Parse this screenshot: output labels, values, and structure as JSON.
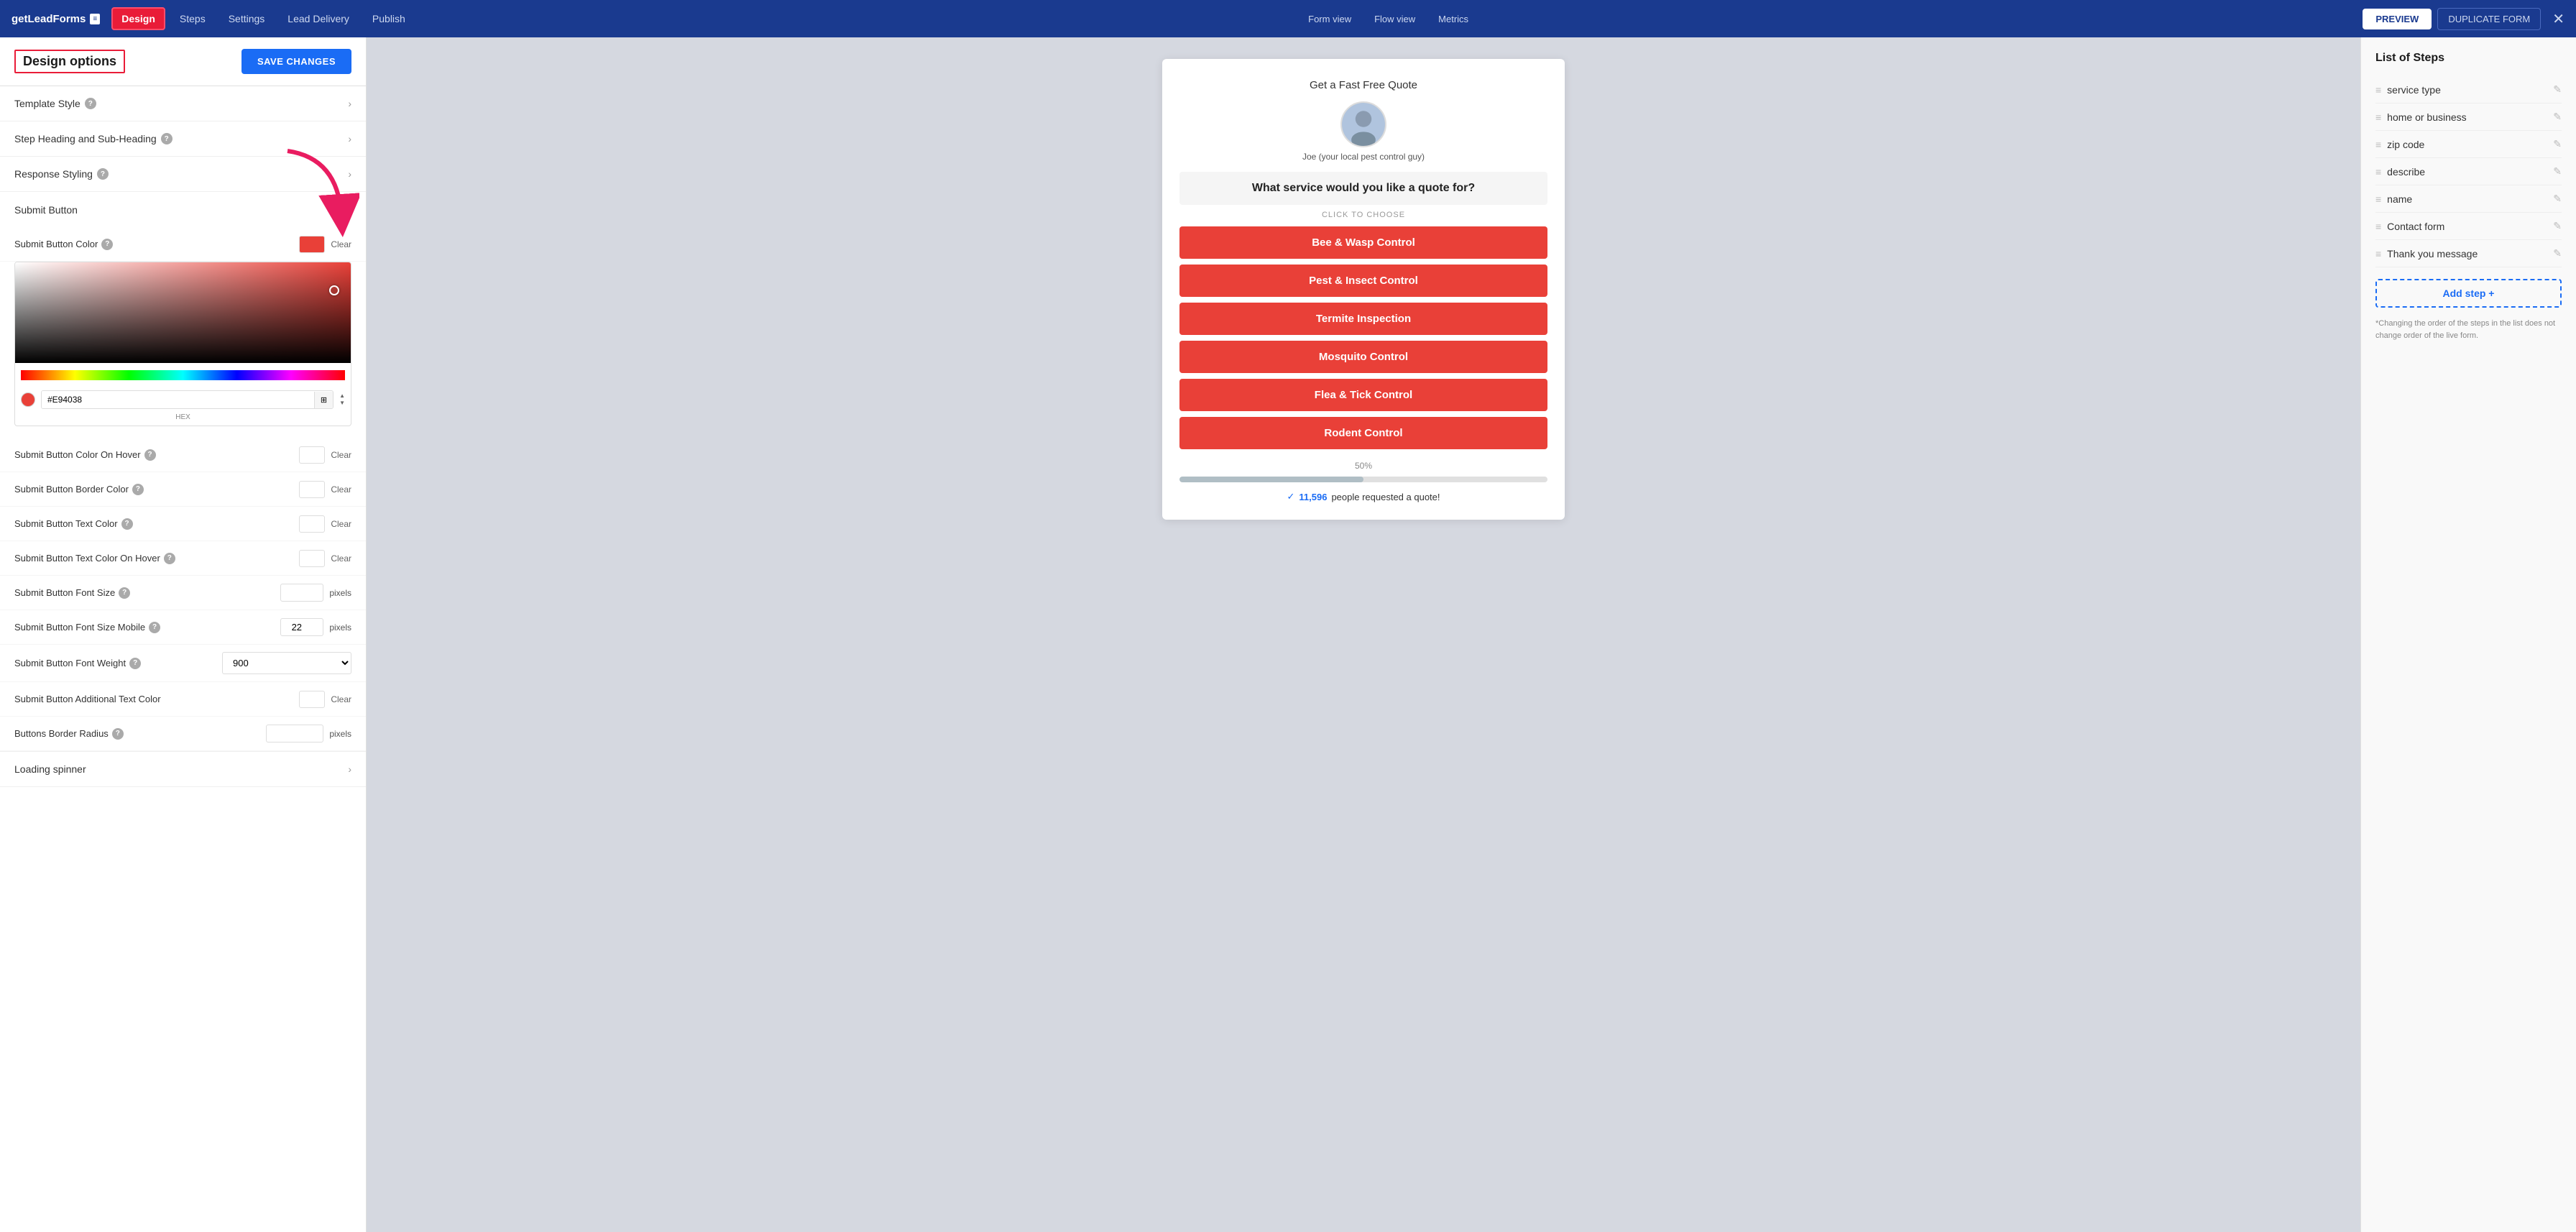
{
  "app": {
    "logo": "getLeadForms",
    "logo_icon": "≡"
  },
  "nav": {
    "items": [
      {
        "id": "design",
        "label": "Design",
        "active": true
      },
      {
        "id": "steps",
        "label": "Steps",
        "active": false
      },
      {
        "id": "settings",
        "label": "Settings",
        "active": false
      },
      {
        "id": "lead-delivery",
        "label": "Lead Delivery",
        "active": false
      },
      {
        "id": "publish",
        "label": "Publish",
        "active": false
      }
    ],
    "view_buttons": [
      {
        "id": "form-view",
        "label": "Form view"
      },
      {
        "id": "flow-view",
        "label": "Flow view"
      },
      {
        "id": "metrics",
        "label": "Metrics"
      }
    ],
    "preview_label": "PREVIEW",
    "duplicate_label": "DUPLICATE FORM",
    "close_label": "✕"
  },
  "left_panel": {
    "title": "Design options",
    "save_label": "SAVE CHANGES",
    "accordion_items": [
      {
        "id": "template-style",
        "label": "Template Style",
        "has_info": true,
        "expanded": false
      },
      {
        "id": "step-heading",
        "label": "Step Heading and Sub-Heading",
        "has_info": true,
        "expanded": false
      },
      {
        "id": "response-styling",
        "label": "Response Styling",
        "has_info": true,
        "expanded": false
      },
      {
        "id": "submit-button",
        "label": "Submit Button",
        "has_info": false,
        "expanded": true
      }
    ],
    "submit_button_settings": [
      {
        "id": "submit-btn-color",
        "label": "Submit Button Color",
        "has_info": true,
        "control_type": "color",
        "color": "red",
        "show_picker": true
      },
      {
        "id": "submit-btn-hover-color",
        "label": "Submit Button Color On Hover",
        "has_info": true,
        "control_type": "color",
        "color": "empty"
      },
      {
        "id": "submit-btn-border-color",
        "label": "Submit Button Border Color",
        "has_info": true,
        "control_type": "color",
        "color": "empty"
      },
      {
        "id": "submit-btn-text-color",
        "label": "Submit Button Text Color",
        "has_info": true,
        "control_type": "color",
        "color": "empty"
      },
      {
        "id": "submit-btn-text-hover-color",
        "label": "Submit Button Text Color On Hover",
        "has_info": true,
        "control_type": "color",
        "color": "empty"
      },
      {
        "id": "submit-btn-font-size",
        "label": "Submit Button Font Size",
        "has_info": true,
        "control_type": "number",
        "value": "",
        "unit": "pixels"
      },
      {
        "id": "submit-btn-font-size-mobile",
        "label": "Submit Button Font Size Mobile",
        "has_info": true,
        "control_type": "number",
        "value": "22",
        "unit": "pixels"
      },
      {
        "id": "submit-btn-font-weight",
        "label": "Submit Button Font Weight",
        "has_info": true,
        "control_type": "select",
        "value": "900"
      },
      {
        "id": "submit-btn-additional-text-color",
        "label": "Submit Button Additional Text Color",
        "has_info": false,
        "control_type": "color",
        "color": "empty"
      },
      {
        "id": "buttons-border-radius",
        "label": "Buttons Border Radius",
        "has_info": true,
        "control_type": "number-only",
        "value": "",
        "unit": "pixels"
      }
    ],
    "loading_spinner": {
      "label": "Loading spinner",
      "expanded": false
    },
    "color_picker": {
      "hex_value": "#E94038",
      "hex_label": "HEX"
    }
  },
  "form_preview": {
    "header_text": "Get a Fast Free Quote",
    "avatar_label": "Joe (your local pest control guy)",
    "question": "What service would you like a quote for?",
    "click_label": "CLICK TO CHOOSE",
    "choices": [
      "Bee & Wasp Control",
      "Pest & Insect Control",
      "Termite Inspection",
      "Mosquito Control",
      "Flea & Tick Control",
      "Rodent Control"
    ],
    "progress_pct": "50%",
    "social_proof": {
      "count": "11,596",
      "label": "people requested a quote!"
    }
  },
  "right_panel": {
    "title": "List of Steps",
    "steps": [
      {
        "id": "service-type",
        "label": "service type"
      },
      {
        "id": "home-or-business",
        "label": "home or business"
      },
      {
        "id": "zip-code",
        "label": "zip code"
      },
      {
        "id": "describe",
        "label": "describe"
      },
      {
        "id": "name",
        "label": "name"
      },
      {
        "id": "contact-form",
        "label": "Contact form"
      },
      {
        "id": "thank-you",
        "label": "Thank you message"
      }
    ],
    "add_step_label": "Add step +",
    "note": "*Changing the order of the steps in the list does not change order of the live form."
  }
}
